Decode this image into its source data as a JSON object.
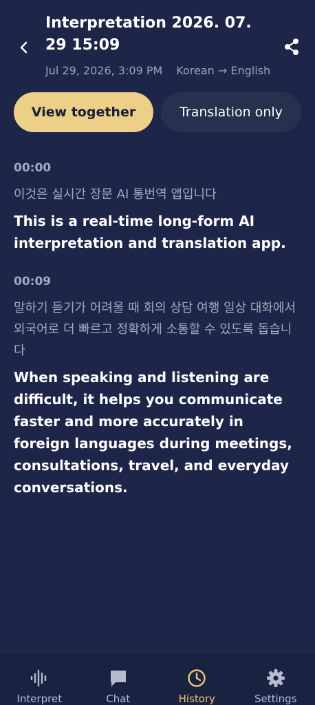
{
  "header": {
    "title": "Interpretation 2026. 07. 29 15:09",
    "datetime": "Jul 29, 2026, 3:09 PM",
    "languages": "Korean → English"
  },
  "tabs": [
    {
      "label": "View together",
      "active": true
    },
    {
      "label": "Translation only",
      "active": false
    }
  ],
  "transcript": [
    {
      "time": "00:00",
      "source": "이것은 실시간 장문 AI 통번역 앱입니다",
      "translation": "This is a real-time long-form AI interpretation and translation app."
    },
    {
      "time": "00:09",
      "source": "말하기 듣기가 어려울 때 회의 상담 여행 일상 대화에서 외국어로 더 빠르고 정확하게 소통할 수 있도록 돕습니다",
      "translation": "When speaking and listening are difficult, it helps you communicate faster and more accurately in foreign languages during meetings, consultations, travel, and everyday conversations."
    }
  ],
  "nav": [
    {
      "label": "Interpret",
      "icon": "waveform-icon",
      "active": false
    },
    {
      "label": "Chat",
      "icon": "chat-icon",
      "active": false
    },
    {
      "label": "History",
      "icon": "clock-icon",
      "active": true
    },
    {
      "label": "Settings",
      "icon": "gear-icon",
      "active": false
    }
  ],
  "colors": {
    "background": "#1d2648",
    "accent": "#ecd088",
    "active_nav": "#ecc66f"
  }
}
